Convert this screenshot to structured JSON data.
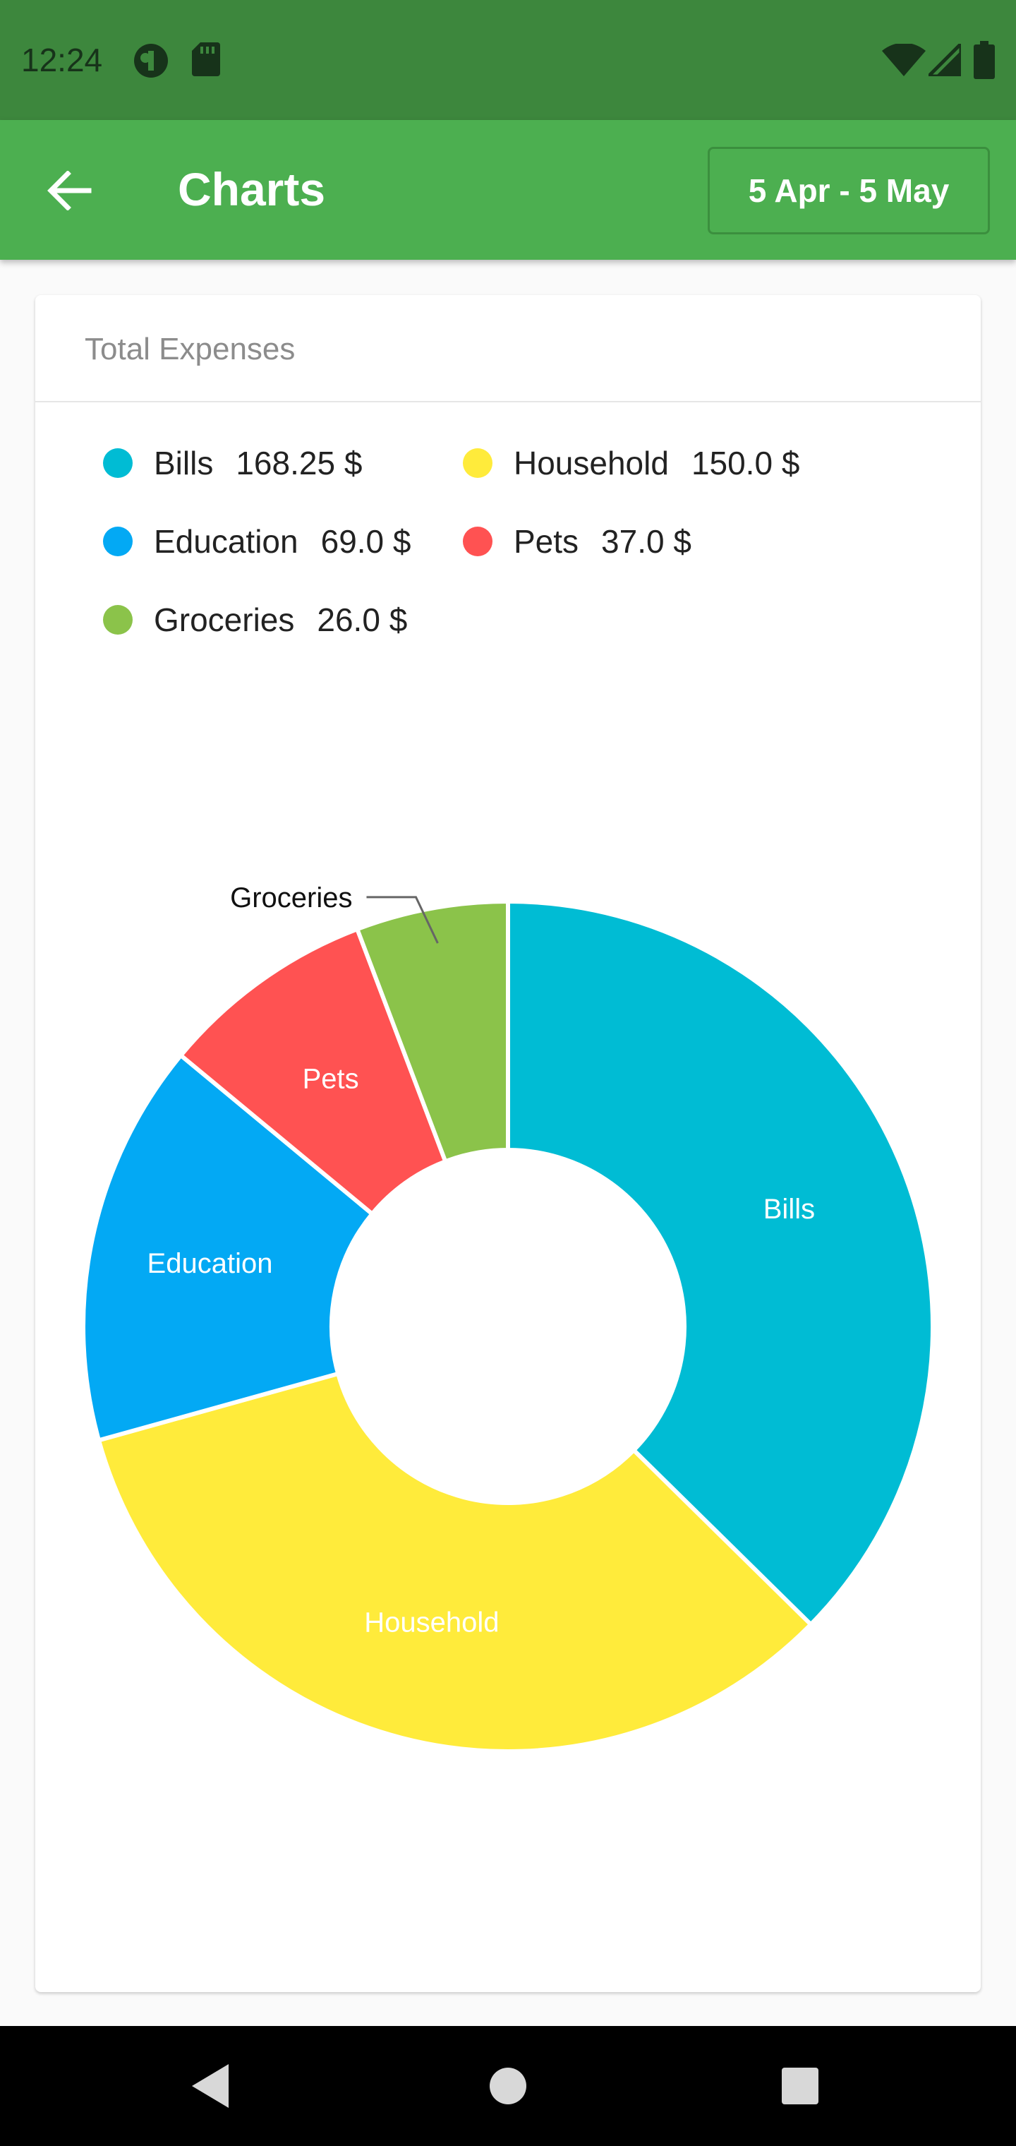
{
  "status_bar": {
    "time": "12:24",
    "icons": [
      "app-notification-icon",
      "sd-card-icon",
      "wifi-icon",
      "cell-signal-icon",
      "battery-icon"
    ]
  },
  "app_bar": {
    "back_icon": "arrow-back-icon",
    "title": "Charts",
    "date_range": "5 Apr - 5 May",
    "color": "#4caf50"
  },
  "card": {
    "title": "Total Expenses",
    "legend": [
      {
        "label": "Bills",
        "amount": "168.25 $",
        "color": "#00bcd4"
      },
      {
        "label": "Household",
        "amount": "150.0 $",
        "color": "#ffeb3b"
      },
      {
        "label": "Education",
        "amount": "69.0 $",
        "color": "#03a9f4"
      },
      {
        "label": "Pets",
        "amount": "37.0 $",
        "color": "#ff5252"
      },
      {
        "label": "Groceries",
        "amount": "26.0 $",
        "color": "#8bc34a"
      }
    ]
  },
  "chart_data": {
    "type": "pie",
    "variant": "donut",
    "categories": [
      "Bills",
      "Household",
      "Education",
      "Pets",
      "Groceries"
    ],
    "values": [
      168.25,
      150.0,
      69.0,
      37.0,
      26.0
    ],
    "colors": [
      "#00bcd4",
      "#ffeb3b",
      "#03a9f4",
      "#ff5252",
      "#8bc34a"
    ],
    "unit": "$",
    "slice_labels": [
      "Bills",
      "Household",
      "Education",
      "Pets",
      "Groceries"
    ],
    "outside_labels": [
      "Groceries"
    ],
    "start_angle": "12 o'clock",
    "direction": "clockwise"
  },
  "nav_bar": {
    "icons": [
      "nav-back-icon",
      "nav-home-icon",
      "nav-recents-icon"
    ]
  }
}
